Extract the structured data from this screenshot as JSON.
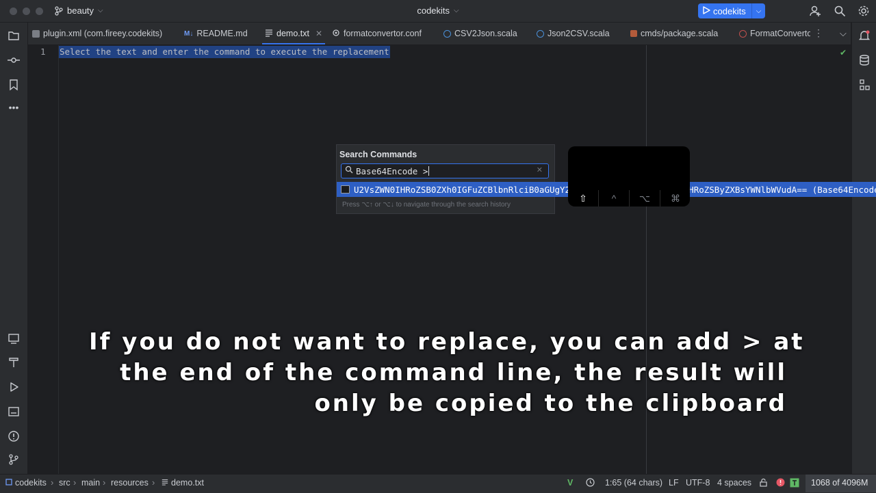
{
  "titlebar": {
    "project": "beauty",
    "title": "codekits",
    "run_label": "codekits"
  },
  "tabs": [
    {
      "label": "plugin.xml (com.fireey.codekits)",
      "icon": "plugin-icon"
    },
    {
      "label": "README.md",
      "icon": "markdown-icon"
    },
    {
      "label": "demo.txt",
      "icon": "text-file-icon",
      "active": true
    },
    {
      "label": "formatconvertor.conf",
      "icon": "config-icon"
    },
    {
      "label": "CSV2Json.scala",
      "icon": "scala-icon"
    },
    {
      "label": "Json2CSV.scala",
      "icon": "scala-icon"
    },
    {
      "label": "cmds/package.scala",
      "icon": "scala-icon"
    },
    {
      "label": "FormatConverto",
      "icon": "scala-icon"
    }
  ],
  "editor": {
    "line_number": "1",
    "line_text": "Select the text and enter the command to execute the replacement"
  },
  "popup": {
    "title": "Search Commands",
    "search_value": "Base64Encode >",
    "result_text": "U2VsZWN0IHRoZSB0ZXh0IGFuZCBlbnRlciB0aGUgY29tbWFuZCB0byBleGVjdXRlIHRoZSByZXBsYWNlbWVudA== (Base64Encode",
    "hint": "Press ⌥↑ or ⌥↓ to navigate through the search history"
  },
  "keys": [
    {
      "symbol": "⇧",
      "pressed": true
    },
    {
      "symbol": "^",
      "pressed": false
    },
    {
      "symbol": "⌥",
      "pressed": false
    },
    {
      "symbol": "⌘",
      "pressed": false
    }
  ],
  "caption": [
    "If you do not want to replace, you can add > at",
    "the end of the command line, the result will",
    "only be copied to the clipboard"
  ],
  "statusbar": {
    "breadcrumb": [
      "codekits",
      "src",
      "main",
      "resources",
      "demo.txt"
    ],
    "position": "1:65 (64 chars)",
    "line_ending": "LF",
    "encoding": "UTF-8",
    "indent": "4 spaces",
    "memory": "1068 of 4096M"
  },
  "colors": {
    "accent": "#3574f0",
    "selection": "#214283",
    "result_highlight": "#2e5fc4",
    "background": "#1e1f22",
    "panel": "#2b2d30"
  }
}
